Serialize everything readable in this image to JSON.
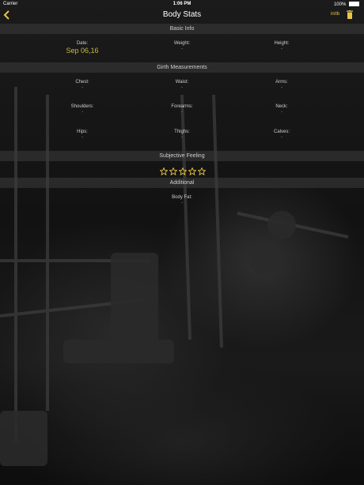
{
  "status_bar": {
    "carrier": "Carrier",
    "time": "1:06 PM",
    "battery": "100%"
  },
  "nav": {
    "title": "Body Stats",
    "unit_toggle": "in/lb"
  },
  "sections": {
    "basic_info": "Basic Info",
    "girth": "Girth Measurements",
    "subjective": "Subjective Feeling",
    "additional": "Additional"
  },
  "basic_info": {
    "date": {
      "label": "Date:",
      "value": "Sep 06,16"
    },
    "weight": {
      "label": "Weight:",
      "value": "-"
    },
    "height": {
      "label": "Height:",
      "value": "-"
    }
  },
  "girth": {
    "chest": {
      "label": "Chest:",
      "value": "-"
    },
    "waist": {
      "label": "Waist:",
      "value": "-"
    },
    "arms": {
      "label": "Arms:",
      "value": "-"
    },
    "shoulders": {
      "label": "Shoulders:",
      "value": "-"
    },
    "forearms": {
      "label": "Forearms:",
      "value": "-"
    },
    "neck": {
      "label": "Neck:",
      "value": "-"
    },
    "hips": {
      "label": "Hips:",
      "value": "-"
    },
    "thighs": {
      "label": "Thighs:",
      "value": "-"
    },
    "calves": {
      "label": "Calves:",
      "value": "-"
    }
  },
  "subjective": {
    "rating": 0,
    "max": 5
  },
  "additional": {
    "body_fat": {
      "label": "Body Fat:",
      "value": "-"
    }
  },
  "colors": {
    "accent": "#e8c547",
    "date_value": "#c9b94a"
  }
}
